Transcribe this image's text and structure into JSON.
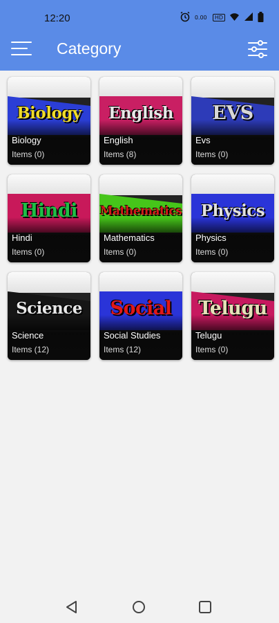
{
  "status_bar": {
    "time": "12:20",
    "icons": [
      "alarm-icon",
      "data-speed-icon",
      "hd-voice-icon",
      "wifi-icon",
      "signal-icon",
      "battery-icon"
    ],
    "speed_text": "0.00",
    "hd_text": "HD"
  },
  "app_bar": {
    "title": "Category",
    "menu_icon": "menu-icon",
    "filter_icon": "filter-icon",
    "color": "#5a8be7"
  },
  "categories": [
    {
      "cover": "Biology",
      "name": "Biology",
      "count": "Items (0)",
      "band": "#2b3ed6",
      "word": "#f0dc2a"
    },
    {
      "cover": "English",
      "name": "English",
      "count": "Items (8)",
      "band": "#c91f63",
      "word": "#e8e8e8"
    },
    {
      "cover": "EVS",
      "name": "Evs",
      "count": "Items (0)",
      "band": "#2d3bb8",
      "word": "#d8d8d8"
    },
    {
      "cover": "Hindi",
      "name": "Hindi",
      "count": "Items (0)",
      "band": "#c8195a",
      "word": "#1fbd45"
    },
    {
      "cover": "Mathematics",
      "name": "Mathematics",
      "count": "Items (0)",
      "band": "#46c51a",
      "word": "#d41a1a"
    },
    {
      "cover": "Physics",
      "name": "Physics",
      "count": "Items (0)",
      "band": "#2a34d8",
      "word": "#e0e0e0"
    },
    {
      "cover": "Science",
      "name": "Science",
      "count": "Items (12)",
      "band": "#151515",
      "word": "#e8e8e8"
    },
    {
      "cover": "Social",
      "name": "Social Studies",
      "count": "Items (12)",
      "band": "#2a34d8",
      "word": "#e01818"
    },
    {
      "cover": "Telugu",
      "name": "Telugu",
      "count": "Items (0)",
      "band": "#c7195f",
      "word": "#e6e0b8"
    }
  ],
  "nav_bar": {
    "back_icon": "back-icon",
    "home_icon": "home-icon",
    "recents_icon": "recents-icon"
  }
}
